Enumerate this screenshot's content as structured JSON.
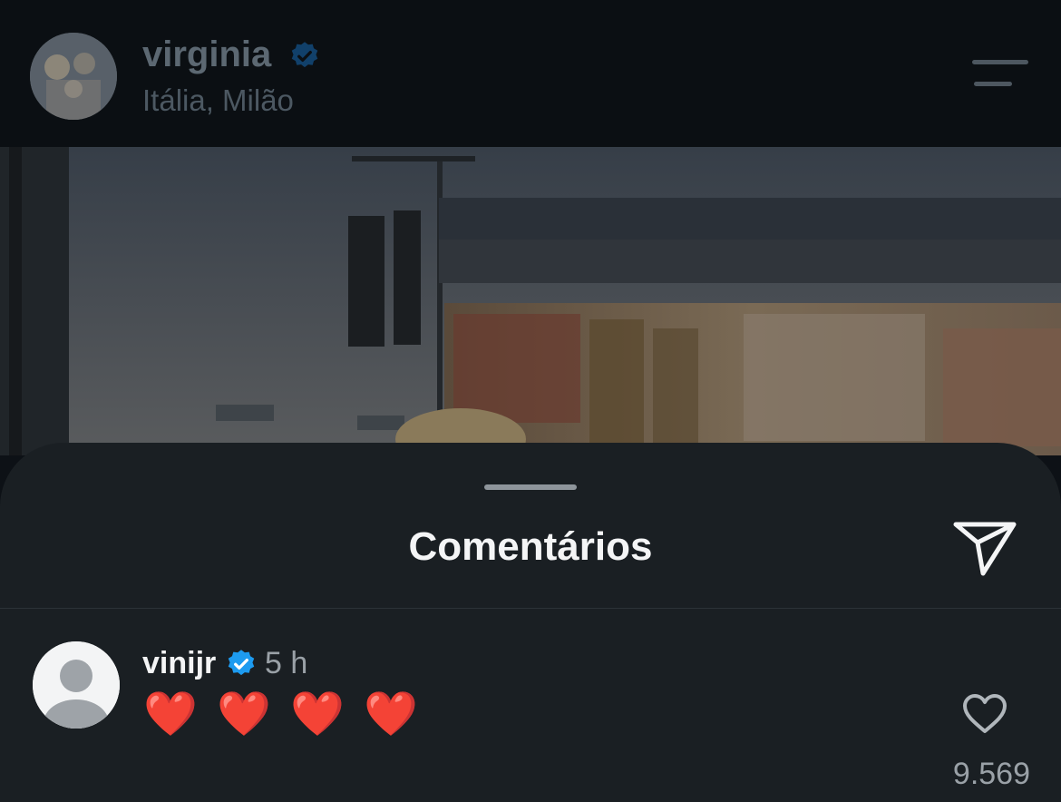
{
  "post": {
    "username": "virginia",
    "location": "Itália, Milão",
    "verified": true
  },
  "comments_sheet": {
    "title": "Comentários"
  },
  "comments": [
    {
      "username": "vinijr",
      "verified": true,
      "time": "5 h",
      "text": "❤️ ❤️ ❤️ ❤️",
      "like_count": "9.569"
    }
  ],
  "icons": {
    "menu": "menu-icon",
    "send": "send-icon",
    "verified": "verified-badge-icon",
    "heart": "heart-outline-icon",
    "avatar_placeholder": "default-avatar-icon"
  },
  "colors": {
    "verified_blue": "#1d9bf0",
    "sheet_bg": "#1a1f23",
    "header_bg": "#0b0f13"
  }
}
